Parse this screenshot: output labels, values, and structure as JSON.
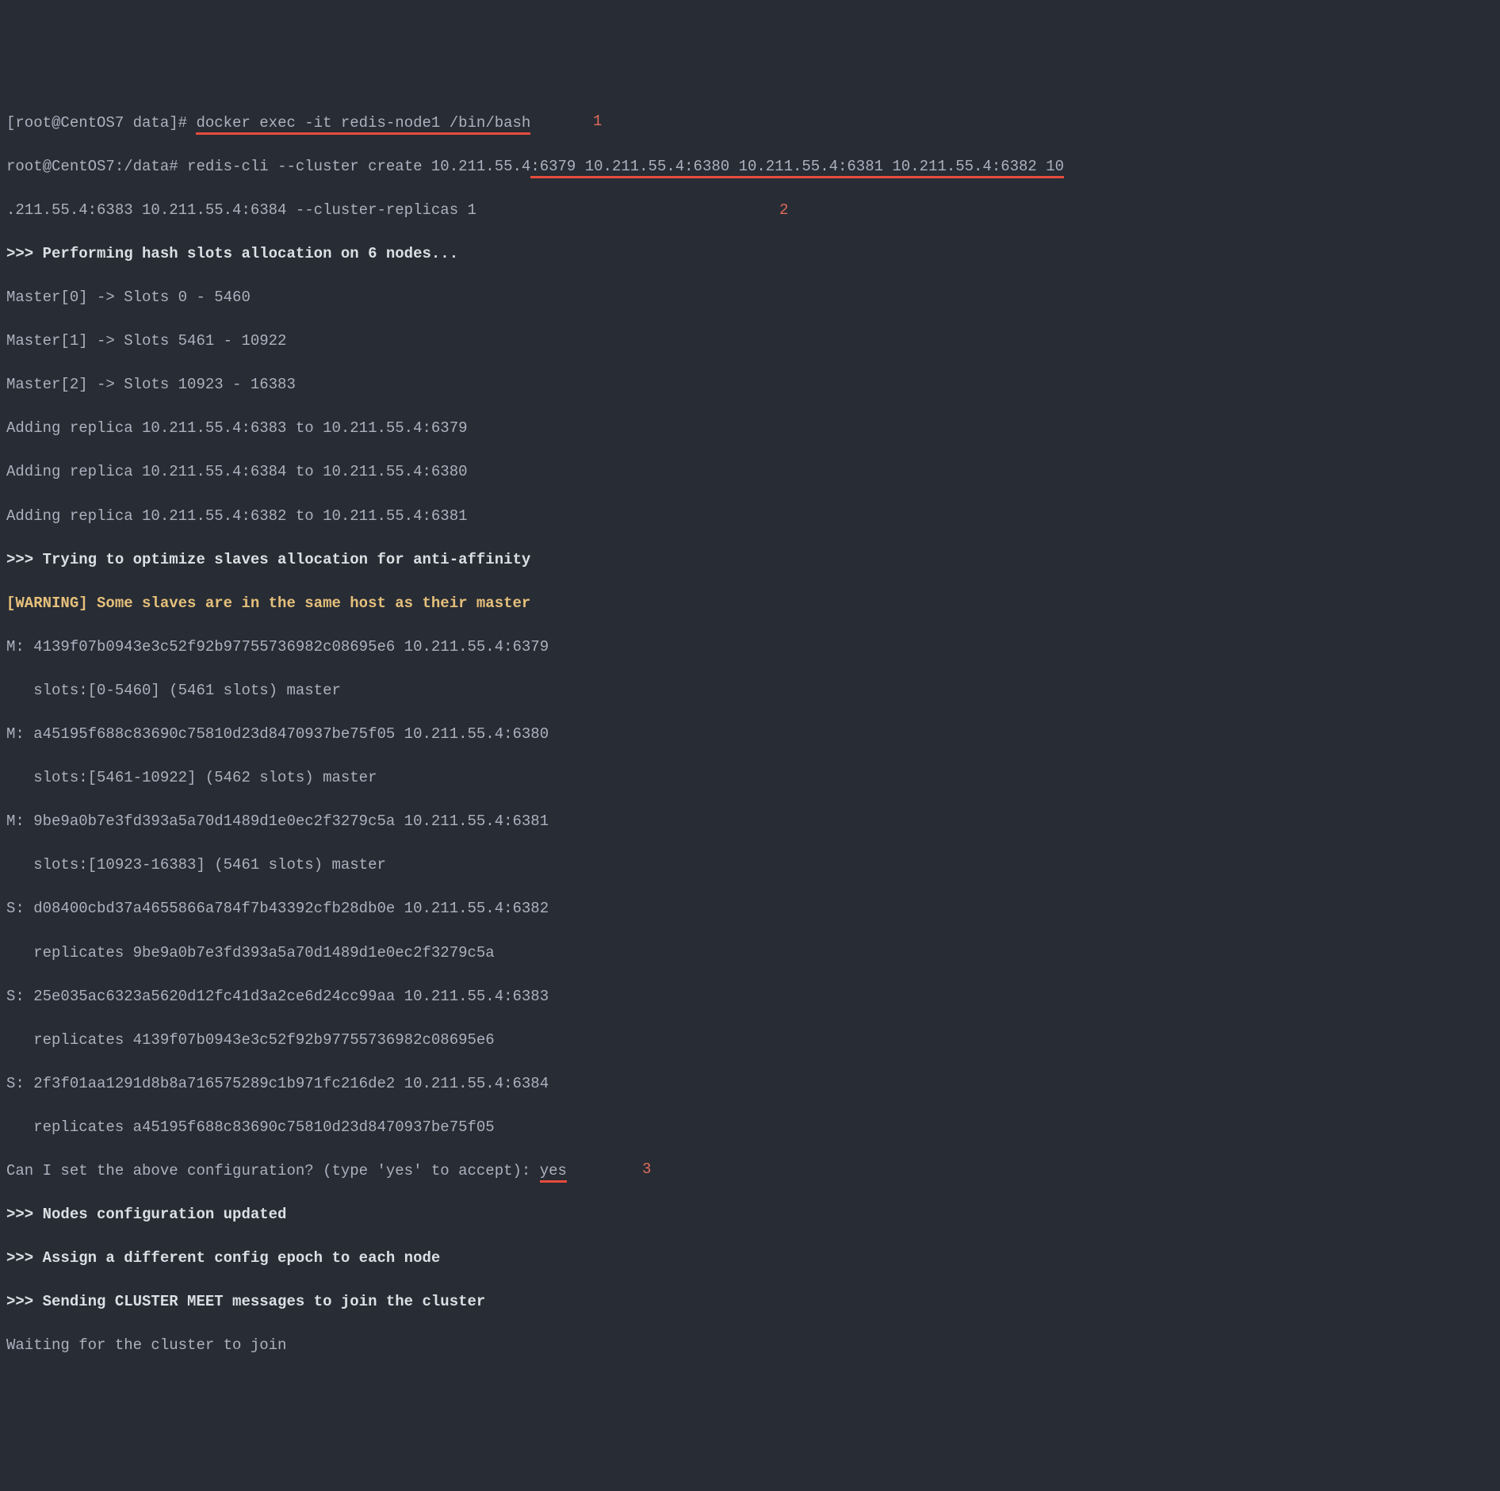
{
  "annotations": {
    "a1": "1",
    "a2": "2",
    "a3": "3"
  },
  "lines": {
    "l1_prompt": "[root@CentOS7 data]# ",
    "l1_cmd": "docker exec -it redis-node1 /bin/bash",
    "l2_prompt": "root@CentOS7:/data# ",
    "l2_cmd_a": "redis-cli --cluster create 10.211.55.4",
    "l2_cmd_b": ":6379 10.211.55.4:6380 10.211.55.4:6381 10.211.55.4:6382 10",
    "l3": ".211.55.4:6383 10.211.55.4:6384 --cluster-replicas 1",
    "l4": ">>> Performing hash slots allocation on 6 nodes...",
    "l5": "Master[0] -> Slots 0 - 5460",
    "l6": "Master[1] -> Slots 5461 - 10922",
    "l7": "Master[2] -> Slots 10923 - 16383",
    "l8": "Adding replica 10.211.55.4:6383 to 10.211.55.4:6379",
    "l9": "Adding replica 10.211.55.4:6384 to 10.211.55.4:6380",
    "l10": "Adding replica 10.211.55.4:6382 to 10.211.55.4:6381",
    "l11": ">>> Trying to optimize slaves allocation for anti-affinity",
    "l12": "[WARNING] Some slaves are in the same host as their master",
    "l13": "M: 4139f07b0943e3c52f92b97755736982c08695e6 10.211.55.4:6379",
    "l14": "   slots:[0-5460] (5461 slots) master",
    "l15": "M: a45195f688c83690c75810d23d8470937be75f05 10.211.55.4:6380",
    "l16": "   slots:[5461-10922] (5462 slots) master",
    "l17": "M: 9be9a0b7e3fd393a5a70d1489d1e0ec2f3279c5a 10.211.55.4:6381",
    "l18": "   slots:[10923-16383] (5461 slots) master",
    "l19": "S: d08400cbd37a4655866a784f7b43392cfb28db0e 10.211.55.4:6382",
    "l20": "   replicates 9be9a0b7e3fd393a5a70d1489d1e0ec2f3279c5a",
    "l21": "S: 25e035ac6323a5620d12fc41d3a2ce6d24cc99aa 10.211.55.4:6383",
    "l22": "   replicates 4139f07b0943e3c52f92b97755736982c08695e6",
    "l23": "S: 2f3f01aa1291d8b8a716575289c1b971fc216de2 10.211.55.4:6384",
    "l24": "   replicates a45195f688c83690c75810d23d8470937be75f05",
    "l25_a": "Can I set the above configuration? (type 'yes' to accept): ",
    "l25_b": "yes",
    "l26": ">>> Nodes configuration updated",
    "l27": ">>> Assign a different config epoch to each node",
    "l28": ">>> Sending CLUSTER MEET messages to join the cluster",
    "l29": "Waiting for the cluster to join"
  }
}
